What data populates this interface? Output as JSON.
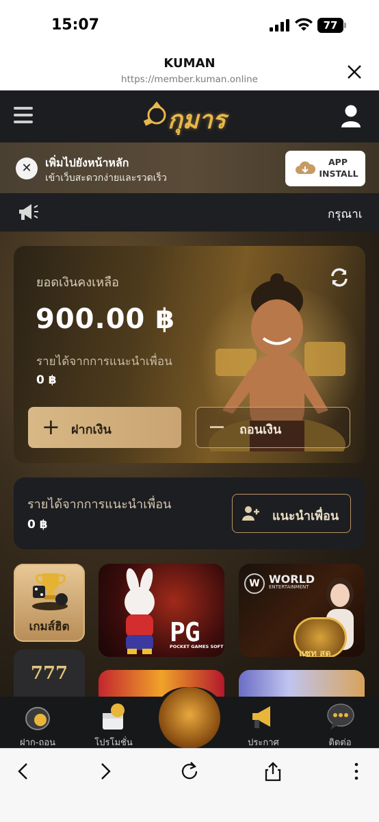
{
  "status_bar": {
    "time": "15:07",
    "battery": "77"
  },
  "browser": {
    "title": "KUMAN",
    "url": "https://member.kuman.online"
  },
  "header": {
    "logo_text": "กุมาร"
  },
  "a2hs": {
    "title": "เพิ่มไปยังหน้าหลัก",
    "subtitle": "เข้าเว็บสะดวกง่ายและรวดเร็ว",
    "button_line1": "APP",
    "button_line2": "INSTALL"
  },
  "marquee": {
    "text": "กรุณาเ"
  },
  "wallet": {
    "balance_label": "ยอดเงินคงเหลือ",
    "balance": "900.00 ฿",
    "referral_label": "รายได้จากการแนะนำเพื่อน",
    "referral_amount": "0 ฿",
    "deposit_label": "ฝากเงิน",
    "withdraw_label": "ถอนเงิน"
  },
  "referral": {
    "label": "รายได้จากการแนะนำเพื่อน",
    "amount": "0 ฿",
    "button_label": "แนะนำเพื่อน"
  },
  "categories": {
    "hit_label": "เกมส์ฮิต",
    "slot_label": "777"
  },
  "tiles": {
    "pg_logo": "PG",
    "pg_sub": "POCKET GAMES SOFT",
    "world_title": "WORLD",
    "world_sub": "ENTERTAINMENT",
    "world_badge": "W",
    "world_live": "แชท สด"
  },
  "bottom_nav": {
    "deposit_withdraw": "ฝาก-ถอน",
    "promotion": "โปรโมชั่น",
    "announce": "ประกาศ",
    "contact": "ติดต่อ"
  },
  "colors": {
    "gold": "#c9a472",
    "dark": "#1c1d20",
    "accent_gold": "#e7b84a"
  }
}
